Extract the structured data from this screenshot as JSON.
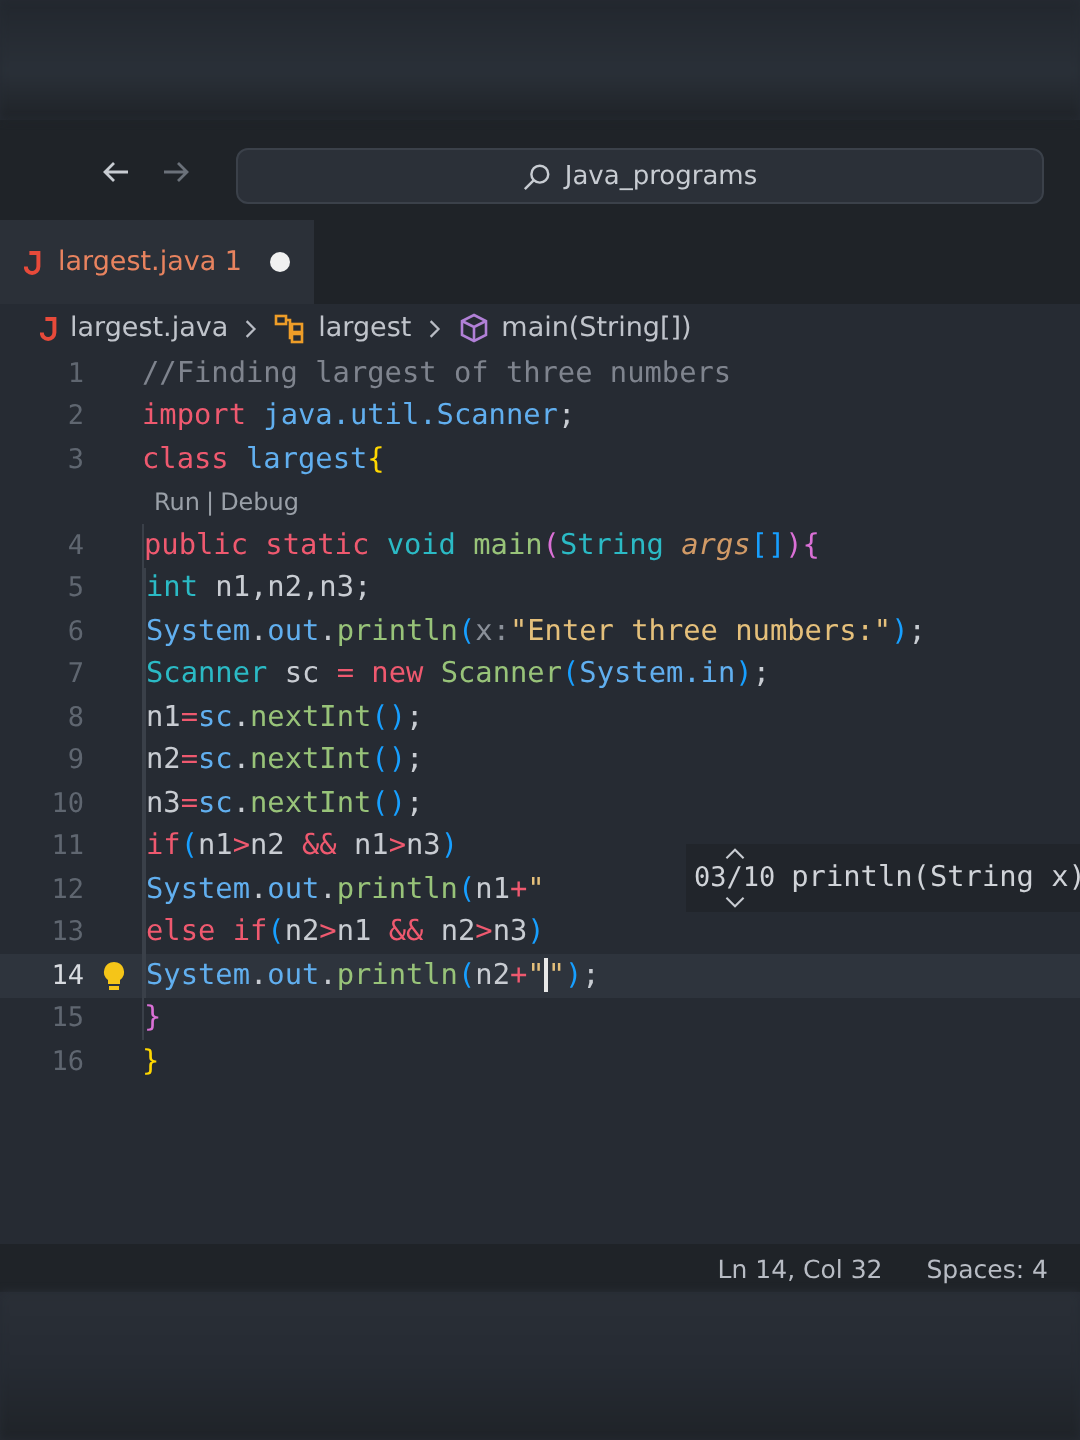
{
  "title_bar": {
    "search": "Java_programs"
  },
  "tabs": [
    {
      "label": "largest.java 1",
      "selected": true,
      "modified": true
    }
  ],
  "breadcrumb": [
    "largest.java",
    "largest",
    "main(String[])"
  ],
  "editor": {
    "lines": [
      {
        "kind": "code",
        "number": "1",
        "current": false,
        "tokens": [
          {
            "text": "//Finding largest of three numbers",
            "kind": "comment"
          }
        ]
      },
      {
        "kind": "code",
        "number": "2",
        "current": false,
        "tokens": [
          {
            "text": "import ",
            "kind": "keyword"
          },
          {
            "text": "java.util.Scanner",
            "kind": "ident"
          },
          {
            "text": ";",
            "kind": "plain"
          }
        ]
      },
      {
        "kind": "code",
        "number": "3",
        "current": false,
        "tokens": [
          {
            "text": "class ",
            "kind": "keyword"
          },
          {
            "text": "largest",
            "kind": "ident"
          },
          {
            "text": "{",
            "kind": "b1"
          }
        ]
      },
      {
        "kind": "codelens",
        "items": [
          "Run",
          "Debug"
        ],
        "separator": "|"
      },
      {
        "kind": "code",
        "number": "4",
        "current": false,
        "tokens": [
          {
            "text": "    public ",
            "kind": "keyword"
          },
          {
            "text": "static ",
            "kind": "keyword"
          },
          {
            "text": "void ",
            "kind": "type"
          },
          {
            "text": "main",
            "kind": "func"
          },
          {
            "text": "(",
            "kind": "b2"
          },
          {
            "text": "String ",
            "kind": "type"
          },
          {
            "text": "args",
            "kind": "param"
          },
          {
            "text": "[]",
            "kind": "b3"
          },
          {
            "text": ")",
            "kind": "b2"
          },
          {
            "text": "{",
            "kind": "b2"
          }
        ]
      },
      {
        "kind": "code",
        "number": "5",
        "current": false,
        "tokens": [
          {
            "text": "        int",
            "kind": "type"
          },
          {
            "text": " n1,n2,n3;",
            "kind": "plain"
          }
        ]
      },
      {
        "kind": "code",
        "number": "6",
        "current": false,
        "tokens": [
          {
            "text": "        System",
            "kind": "ident"
          },
          {
            "text": ".",
            "kind": "plain"
          },
          {
            "text": "out",
            "kind": "ident"
          },
          {
            "text": ".",
            "kind": "plain"
          },
          {
            "text": "println",
            "kind": "func"
          },
          {
            "text": "(",
            "kind": "b3"
          },
          {
            "text": "x:",
            "kind": "hint"
          },
          {
            "text": "\"Enter three numbers:\"",
            "kind": "string"
          },
          {
            "text": ")",
            "kind": "b3"
          },
          {
            "text": ";",
            "kind": "plain"
          }
        ]
      },
      {
        "kind": "code",
        "number": "7",
        "current": false,
        "tokens": [
          {
            "text": "        Scanner",
            "kind": "type"
          },
          {
            "text": " sc ",
            "kind": "plain"
          },
          {
            "text": "= ",
            "kind": "keyword"
          },
          {
            "text": "new ",
            "kind": "keyword"
          },
          {
            "text": "Scanner",
            "kind": "func"
          },
          {
            "text": "(",
            "kind": "b3"
          },
          {
            "text": "System.in",
            "kind": "ident"
          },
          {
            "text": ")",
            "kind": "b3"
          },
          {
            "text": ";",
            "kind": "plain"
          }
        ]
      },
      {
        "kind": "code",
        "number": "8",
        "current": false,
        "tokens": [
          {
            "text": "        n1",
            "kind": "plain"
          },
          {
            "text": "=",
            "kind": "keyword"
          },
          {
            "text": "sc",
            "kind": "ident"
          },
          {
            "text": ".",
            "kind": "plain"
          },
          {
            "text": "nextInt",
            "kind": "func"
          },
          {
            "text": "()",
            "kind": "b3"
          },
          {
            "text": ";",
            "kind": "plain"
          }
        ]
      },
      {
        "kind": "code",
        "number": "9",
        "current": false,
        "tokens": [
          {
            "text": "        n2",
            "kind": "plain"
          },
          {
            "text": "=",
            "kind": "keyword"
          },
          {
            "text": "sc",
            "kind": "ident"
          },
          {
            "text": ".",
            "kind": "plain"
          },
          {
            "text": "nextInt",
            "kind": "func"
          },
          {
            "text": "()",
            "kind": "b3"
          },
          {
            "text": ";",
            "kind": "plain"
          }
        ]
      },
      {
        "kind": "code",
        "number": "10",
        "current": false,
        "tokens": [
          {
            "text": "        n3",
            "kind": "plain"
          },
          {
            "text": "=",
            "kind": "keyword"
          },
          {
            "text": "sc",
            "kind": "ident"
          },
          {
            "text": ".",
            "kind": "plain"
          },
          {
            "text": "nextInt",
            "kind": "func"
          },
          {
            "text": "()",
            "kind": "b3"
          },
          {
            "text": ";",
            "kind": "plain"
          }
        ]
      },
      {
        "kind": "code",
        "number": "11",
        "current": false,
        "tokens": [
          {
            "text": "        if",
            "kind": "keyword"
          },
          {
            "text": "(",
            "kind": "b3"
          },
          {
            "text": "n1",
            "kind": "plain"
          },
          {
            "text": ">",
            "kind": "keyword"
          },
          {
            "text": "n2 ",
            "kind": "plain"
          },
          {
            "text": "&&",
            "kind": "keyword"
          },
          {
            "text": " n1",
            "kind": "plain"
          },
          {
            "text": ">",
            "kind": "keyword"
          },
          {
            "text": "n3",
            "kind": "plain"
          },
          {
            "text": ")",
            "kind": "b3"
          }
        ]
      },
      {
        "kind": "code",
        "number": "12",
        "current": false,
        "tokens": [
          {
            "text": "        System",
            "kind": "ident"
          },
          {
            "text": ".",
            "kind": "plain"
          },
          {
            "text": "out",
            "kind": "ident"
          },
          {
            "text": ".",
            "kind": "plain"
          },
          {
            "text": "println",
            "kind": "func"
          },
          {
            "text": "(",
            "kind": "b3"
          },
          {
            "text": "n1",
            "kind": "plain"
          },
          {
            "text": "+",
            "kind": "keyword"
          },
          {
            "text": "\"",
            "kind": "string"
          }
        ]
      },
      {
        "kind": "code",
        "number": "13",
        "current": false,
        "tokens": [
          {
            "text": "        else if",
            "kind": "keyword"
          },
          {
            "text": "(",
            "kind": "b3"
          },
          {
            "text": "n2",
            "kind": "plain"
          },
          {
            "text": ">",
            "kind": "keyword"
          },
          {
            "text": "n1 ",
            "kind": "plain"
          },
          {
            "text": "&&",
            "kind": "keyword"
          },
          {
            "text": " n2",
            "kind": "plain"
          },
          {
            "text": ">",
            "kind": "keyword"
          },
          {
            "text": "n3",
            "kind": "plain"
          },
          {
            "text": ")",
            "kind": "b3"
          }
        ]
      },
      {
        "kind": "code",
        "number": "14",
        "current": true,
        "tokens": [
          {
            "text": "        System",
            "kind": "ident"
          },
          {
            "text": ".",
            "kind": "plain"
          },
          {
            "text": "out",
            "kind": "ident"
          },
          {
            "text": ".",
            "kind": "plain"
          },
          {
            "text": "println",
            "kind": "func"
          },
          {
            "text": "(",
            "kind": "b3"
          },
          {
            "text": "n2",
            "kind": "plain"
          },
          {
            "text": "+",
            "kind": "keyword"
          },
          {
            "text": "\"",
            "kind": "string",
            "caret_after": true
          },
          {
            "text": "\"",
            "kind": "string"
          },
          {
            "text": ")",
            "kind": "b3"
          },
          {
            "text": ";",
            "kind": "plain"
          }
        ]
      },
      {
        "kind": "code",
        "number": "15",
        "current": false,
        "tokens": [
          {
            "text": "    }",
            "kind": "b2"
          }
        ]
      },
      {
        "kind": "code",
        "number": "16",
        "current": false,
        "tokens": [
          {
            "text": "}",
            "kind": "b1"
          }
        ]
      }
    ]
  },
  "signature_help": {
    "counter": "03/10",
    "signature": "println(String x)"
  },
  "status_bar": [
    "Ln 14, Col 32",
    "Spaces: 4"
  ]
}
